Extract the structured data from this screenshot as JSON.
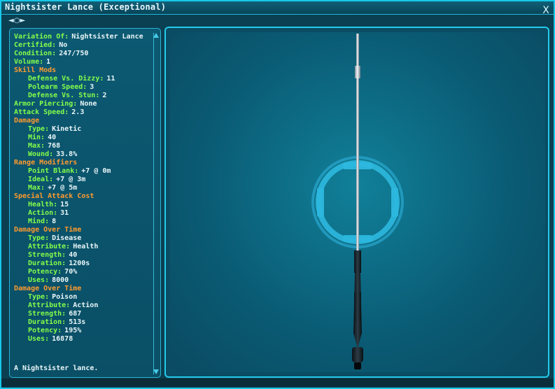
{
  "window": {
    "title": "Nightsister Lance (Exceptional)",
    "close_label": "X",
    "nav_label": "◄○►"
  },
  "attributes": {
    "rows": [
      {
        "k": "Variation Of:",
        "v": "Nightsister Lance"
      },
      {
        "k": "Certified:",
        "v": "No"
      },
      {
        "k": "Condition:",
        "v": "247/750"
      },
      {
        "k": "Volume:",
        "v": "1"
      },
      {
        "section": "Skill Mods"
      },
      {
        "k": "Defense Vs. Dizzy:",
        "v": "11",
        "ind": true
      },
      {
        "k": "Polearm Speed:",
        "v": "3",
        "ind": true
      },
      {
        "k": "Defense Vs. Stun:",
        "v": "2",
        "ind": true
      },
      {
        "k": "Armor Piercing:",
        "v": "None"
      },
      {
        "k": "Attack Speed:",
        "v": "2.3"
      },
      {
        "section": "Damage"
      },
      {
        "k": "Type:",
        "v": "Kinetic",
        "ind": true
      },
      {
        "k": "Min:",
        "v": "40",
        "ind": true
      },
      {
        "k": "Max:",
        "v": "768",
        "ind": true
      },
      {
        "k": "Wound:",
        "v": "33.8%",
        "ind": true
      },
      {
        "section": "Range Modifiers"
      },
      {
        "k": "Point Blank:",
        "v": "+7 @ 0m",
        "ind": true
      },
      {
        "k": "Ideal:",
        "v": "+7 @ 3m",
        "ind": true
      },
      {
        "k": "Max:",
        "v": "+7 @ 5m",
        "ind": true
      },
      {
        "section": "Special Attack Cost"
      },
      {
        "k": "Health:",
        "v": "15",
        "ind": true
      },
      {
        "k": "Action:",
        "v": "31",
        "ind": true
      },
      {
        "k": "Mind:",
        "v": "8",
        "ind": true
      },
      {
        "section": "Damage Over Time"
      },
      {
        "k": "Type:",
        "v": "Disease",
        "ind": true
      },
      {
        "k": "Attribute:",
        "v": "Health",
        "ind": true
      },
      {
        "k": "Strength:",
        "v": "40",
        "ind": true
      },
      {
        "k": "Duration:",
        "v": "1200s",
        "ind": true
      },
      {
        "k": "Potency:",
        "v": "70%",
        "ind": true
      },
      {
        "k": "Uses:",
        "v": "8000",
        "ind": true
      },
      {
        "section": "Damage Over Time"
      },
      {
        "k": "Type:",
        "v": "Poison",
        "ind": true
      },
      {
        "k": "Attribute:",
        "v": "Action",
        "ind": true
      },
      {
        "k": "Strength:",
        "v": "687",
        "ind": true
      },
      {
        "k": "Duration:",
        "v": "513s",
        "ind": true
      },
      {
        "k": "Potency:",
        "v": "195%",
        "ind": true
      },
      {
        "k": "Uses:",
        "v": "16878",
        "ind": true
      }
    ],
    "description": "A Nightsister lance."
  },
  "preview": {
    "object_icon": "lance-icon",
    "ring_icon": "target-ring-icon"
  },
  "colors": {
    "frame": "#18c8e8",
    "key": "#83ff4a",
    "section": "#ff9b2f",
    "value": "#e9f6f8"
  }
}
